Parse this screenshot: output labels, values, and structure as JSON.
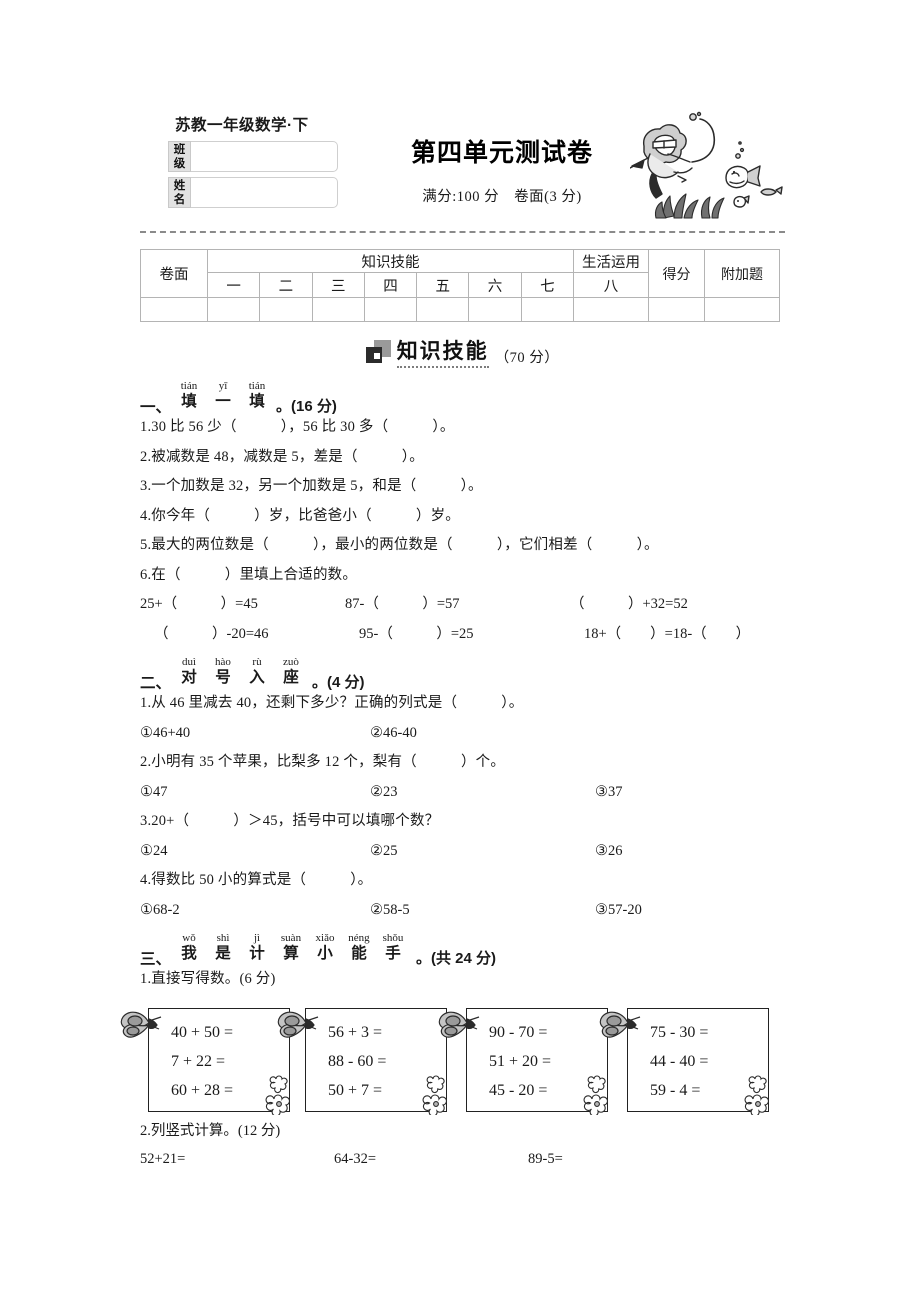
{
  "header": {
    "series_title": "苏教一年级数学·下",
    "main_title": "第四单元测试卷",
    "subtitle": "满分:100 分　卷面(3 分)",
    "class_label_line1": "班",
    "class_label_line2": "级",
    "name_label_line1": "姓",
    "name_label_line2": "名",
    "class_value": "",
    "name_value": "",
    "artwork_name": "diver-underwater-illustration"
  },
  "score_table": {
    "juanmian": "卷面",
    "zhishi_jineng": "知识技能",
    "shenghuo_yunyong": "生活运用",
    "defen": "得分",
    "fujiati": "附加题",
    "skill_numbers": [
      "一",
      "二",
      "三",
      "四",
      "五",
      "六",
      "七"
    ],
    "life_number": "八",
    "empty_cells": [
      "",
      "",
      "",
      "",
      "",
      "",
      "",
      "",
      "",
      ""
    ]
  },
  "banner": {
    "icon": "squares-icon",
    "title": "知识技能",
    "points": "（70 分）"
  },
  "sections": [
    {
      "id": "sec-1",
      "number": "一、",
      "ruby": [
        {
          "py": "tián",
          "hz": "填"
        },
        {
          "py": "yī",
          "hz": "一"
        },
        {
          "py": "tián",
          "hz": "填"
        }
      ],
      "tail": "。(16 分)",
      "questions": [
        "1.30 比 56 少（　　　），56 比 30 多（　　　）。",
        "2.被减数是 48，减数是 5，差是（　　　）。",
        "3.一个加数是 32，另一个加数是 5，和是（　　　）。",
        "4.你今年（　　　）岁，比爸爸小（　　　）岁。",
        "5.最大的两位数是（　　　），最小的两位数是（　　　），它们相差（　　　）。",
        "6.在（　　　）里填上合适的数。"
      ],
      "equation_rows": [
        [
          "25+（　　　）=45",
          "87-（　　　）=57",
          "（　　　）+32=52"
        ],
        [
          "（　　　）-20=46",
          "95-（　　　）=25",
          "18+（　　）=18-（　　）"
        ]
      ]
    },
    {
      "id": "sec-2",
      "number": "二、",
      "ruby": [
        {
          "py": "duì",
          "hz": "对"
        },
        {
          "py": "hào",
          "hz": "号"
        },
        {
          "py": "rù",
          "hz": "入"
        },
        {
          "py": "zuò",
          "hz": "座"
        }
      ],
      "tail": "。(4 分)",
      "items": [
        {
          "stem": "1.从 46 里减去 40，还剩下多少？正确的列式是（　　　）。",
          "options": [
            "①46+40",
            "②46-40",
            ""
          ]
        },
        {
          "stem": "2.小明有 35 个苹果，比梨多 12 个，梨有（　　　）个。",
          "options": [
            "①47",
            "②23",
            "③37"
          ]
        },
        {
          "stem": "3.20+（　　　）＞45，括号中可以填哪个数？",
          "options": [
            "①24",
            "②25",
            "③26"
          ]
        },
        {
          "stem": "4.得数比 50 小的算式是（　　　）。",
          "options": [
            "①68-2",
            "②58-5",
            "③57-20"
          ]
        }
      ]
    },
    {
      "id": "sec-3",
      "number": "三、",
      "ruby": [
        {
          "py": "wǒ",
          "hz": "我"
        },
        {
          "py": "shì",
          "hz": "是"
        },
        {
          "py": "jì",
          "hz": "计"
        },
        {
          "py": "suàn",
          "hz": "算"
        },
        {
          "py": "xiǎo",
          "hz": "小"
        },
        {
          "py": "néng",
          "hz": "能"
        },
        {
          "py": "shǒu",
          "hz": "手"
        }
      ],
      "tail": "。(共 24 分)",
      "sub1_label": "1.直接写得数。(6 分)",
      "calc_boxes": [
        {
          "name": "calc-box-1",
          "lines": [
            "40 + 50 =",
            "7 + 22 =",
            "60 + 28 ="
          ]
        },
        {
          "name": "calc-box-2",
          "lines": [
            "56 + 3 =",
            "88 - 60 =",
            "50 + 7 ="
          ]
        },
        {
          "name": "calc-box-3",
          "lines": [
            "90 - 70 =",
            "51 + 20 =",
            "45 - 20 ="
          ]
        },
        {
          "name": "calc-box-4",
          "lines": [
            "75 - 30 =",
            "44 - 40 =",
            "59 - 4 ="
          ]
        }
      ],
      "sub2_label": "2.列竖式计算。(12 分)",
      "vertical_problems": [
        "52+21=",
        "64-32=",
        "89-5="
      ]
    }
  ]
}
